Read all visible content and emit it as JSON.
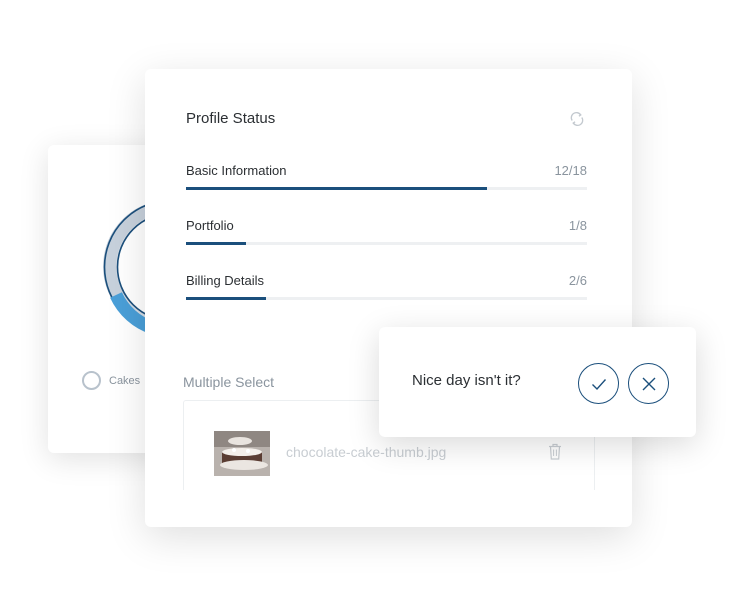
{
  "donut_card": {
    "legend_label": "Cakes"
  },
  "profile_status": {
    "title": "Profile Status",
    "items": [
      {
        "label": "Basic Information",
        "count": "12/18",
        "progress": 0.75
      },
      {
        "label": "Portfolio",
        "count": "1/8",
        "progress": 0.15
      },
      {
        "label": "Billing Details",
        "count": "2/6",
        "progress": 0.2
      }
    ]
  },
  "multiple_select": {
    "label": "Multiple Select",
    "file_name": "chocolate-cake-thumb.jpg"
  },
  "toast": {
    "message": "Nice day isn't it?"
  },
  "colors": {
    "accent": "#1b4f7c",
    "track": "#eef0f2",
    "muted": "#8a949e"
  },
  "icons": [
    "refresh-icon",
    "trash-icon",
    "check-icon",
    "close-icon"
  ]
}
